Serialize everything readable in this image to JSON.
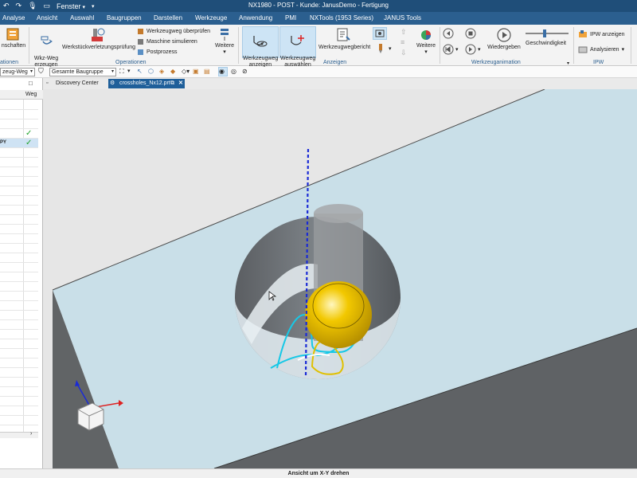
{
  "window": {
    "title": "NX1980 - POST - Kunde: JanusDemo - Fertigung",
    "window_menu_label": "Fenster"
  },
  "menu": {
    "items": [
      "Analyse",
      "Ansicht",
      "Auswahl",
      "Baugruppen",
      "Darstellen",
      "Werkzeuge",
      "Anwendung",
      "PMI",
      "NXTools (1953 Series)",
      "JANUS Tools"
    ]
  },
  "ribbon": {
    "properties_label": "nschaften",
    "operations_left_label": "ationen",
    "create_toolpath_label": "Wkz-Weg\nerzeugen",
    "gouge_check_label": "Werkstückverletzungsprüfung",
    "verify_toolpath_label": "Werkzeugweg überprüfen",
    "simulate_machine_label": "Maschine simulieren",
    "postprocess_label": "Postprozess",
    "more_label_1": "Weitere",
    "group_operations": "Operationen",
    "show_toolpath_label": "Werkzeugweg\nanzeigen",
    "select_toolpath_label": "Werkzeugweg\nauswählen",
    "toolpath_report_label": "Werkzeugwegbericht",
    "more_label_2": "Weitere",
    "group_display": "Anzeigen",
    "replay_label": "Wiedergeben",
    "speed_label": "Geschwindigkeit",
    "group_animation": "Werkzeuganimation",
    "ipw_show_label": "IPW anzeigen",
    "ipw_analyze_label": "Analysieren",
    "group_ipw": "IPW",
    "speed_level": 0.45
  },
  "toolbar": {
    "filter_value": "zeug-Weg",
    "assembly_filter_value": "Gesamte Baugruppe"
  },
  "tabs": [
    {
      "label": "Discovery Center"
    },
    {
      "label": "crossholes_Nx12.prt"
    }
  ],
  "navigator": {
    "column_header": "Weg",
    "rows": [
      {
        "label": "",
        "checked": true
      },
      {
        "label": "PY",
        "checked": true
      }
    ]
  },
  "status": {
    "text": "Ansicht um X-Y drehen"
  },
  "colors": {
    "title_bar": "#1f4e79",
    "menu_bar": "#2b5f8f",
    "active_tab": "#1f5f9a",
    "part_surface": "#c9dfe8",
    "part_side": "#616466",
    "tool_ball": "#e8b900",
    "toolpath": "#17c8e6",
    "tool_axis": "#1a2ad6"
  }
}
